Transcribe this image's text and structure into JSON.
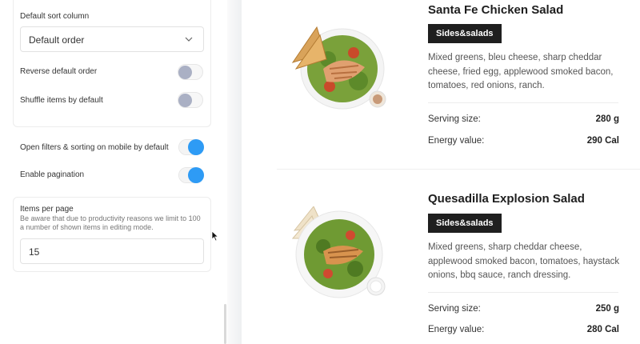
{
  "settings": {
    "sort": {
      "label": "Default sort column",
      "value": "Default order",
      "reverse_label": "Reverse default order",
      "reverse_on": false,
      "shuffle_label": "Shuffle items by default",
      "shuffle_on": false
    },
    "mobile_filters_label": "Open filters & sorting on mobile by default",
    "mobile_filters_on": true,
    "pagination_label": "Enable pagination",
    "pagination_on": true,
    "items_per_page": {
      "label": "Items per page",
      "helper": "Be aware that due to productivity reasons we limit to 100 a number of shown items in editing mode.",
      "value": "15"
    }
  },
  "menu_items": [
    {
      "title": "Santa Fe Chicken Salad",
      "tag": "Sides&salads",
      "description": "Mixed greens, bleu cheese, sharp cheddar cheese, fried egg, applewood smoked bacon, tomatoes, red onions, ranch.",
      "serving_label": "Serving size:",
      "serving_value": "280 g",
      "energy_label": "Energy value:",
      "energy_value": "290 Cal"
    },
    {
      "title": "Quesadilla Explosion Salad",
      "tag": "Sides&salads",
      "description": "Mixed greens, sharp cheddar cheese, applewood smoked bacon, tomatoes, haystack onions, bbq sauce, ranch dressing.",
      "serving_label": "Serving size:",
      "serving_value": "250 g",
      "energy_label": "Energy value:",
      "energy_value": "280 Cal"
    }
  ],
  "colors": {
    "toggle_on": "#2e9bf5",
    "toggle_off": "#aab0c4",
    "tag_bg": "#1f1f1f"
  }
}
